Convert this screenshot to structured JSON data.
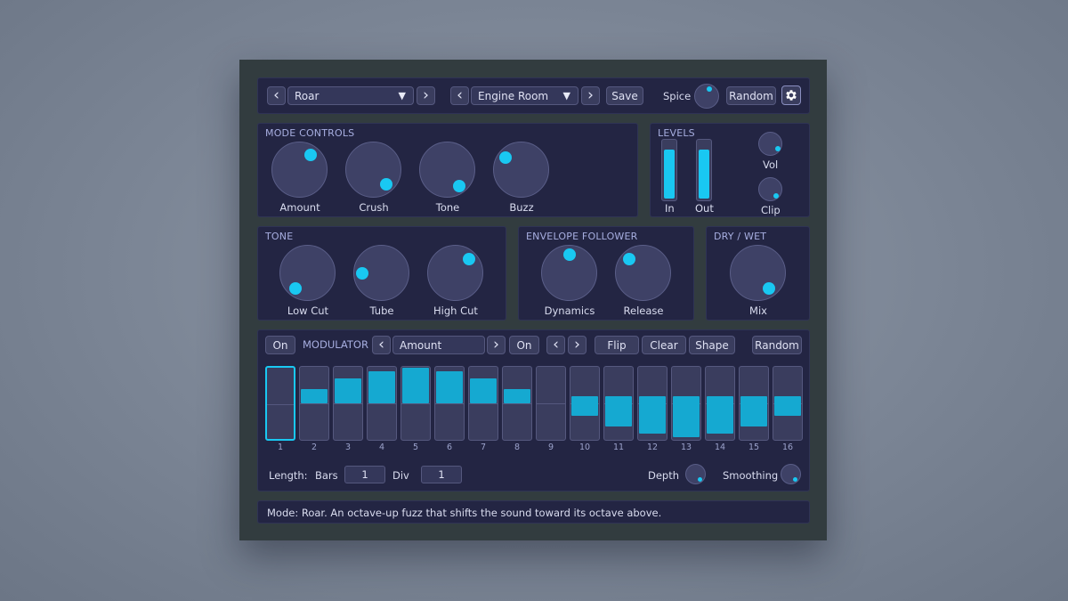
{
  "topbar": {
    "mode_select": "Roar",
    "preset_select": "Engine Room",
    "save_label": "Save",
    "spice_label": "Spice",
    "random_label": "Random",
    "prev_glyph": "‹",
    "next_glyph": "›",
    "chevron_glyph": "▼"
  },
  "mode_controls": {
    "title": "MODE CONTROLS",
    "knobs": [
      {
        "label": "Amount"
      },
      {
        "label": "Crush"
      },
      {
        "label": "Tone"
      },
      {
        "label": "Buzz"
      }
    ]
  },
  "levels": {
    "title": "LEVELS",
    "in_label": "In",
    "out_label": "Out",
    "in_level": 0.83,
    "out_level": 0.83,
    "vol_label": "Vol",
    "clip_label": "Clip"
  },
  "tone": {
    "title": "TONE",
    "knobs": [
      {
        "label": "Low Cut"
      },
      {
        "label": "Tube"
      },
      {
        "label": "High Cut"
      }
    ]
  },
  "envelope": {
    "title": "ENVELOPE FOLLOWER",
    "knobs": [
      {
        "label": "Dynamics"
      },
      {
        "label": "Release"
      }
    ]
  },
  "drywet": {
    "title": "DRY / WET",
    "mix_label": "Mix"
  },
  "modulator": {
    "on_label": "On",
    "title": "MODULATOR",
    "target_select": "Amount",
    "on2_label": "On",
    "flip_label": "Flip",
    "clear_label": "Clear",
    "shape_label": "Shape",
    "random_label": "Random",
    "steps": [
      {
        "n": "1",
        "value": 0.0
      },
      {
        "n": "2",
        "value": 0.2
      },
      {
        "n": "3",
        "value": 0.35
      },
      {
        "n": "4",
        "value": 0.45
      },
      {
        "n": "5",
        "value": 0.5
      },
      {
        "n": "6",
        "value": 0.45
      },
      {
        "n": "7",
        "value": 0.35
      },
      {
        "n": "8",
        "value": 0.2
      },
      {
        "n": "9",
        "value": 0.0
      },
      {
        "n": "10",
        "value": -0.2
      },
      {
        "n": "11",
        "value": -0.35
      },
      {
        "n": "12",
        "value": -0.45
      },
      {
        "n": "13",
        "value": -0.5
      },
      {
        "n": "14",
        "value": -0.45
      },
      {
        "n": "15",
        "value": -0.35
      },
      {
        "n": "16",
        "value": -0.2
      }
    ],
    "length_label": "Length:",
    "bars_label": "Bars",
    "bars_value": "1",
    "div_label": "Div",
    "div_value": "1",
    "depth_label": "Depth",
    "smoothing_label": "Smoothing"
  },
  "status": {
    "text": "Mode: Roar. An octave-up fuzz that shifts the sound toward its octave above."
  },
  "colors": {
    "accent": "#19c8f2",
    "panel": "#232543",
    "frame": "#323c3f"
  }
}
